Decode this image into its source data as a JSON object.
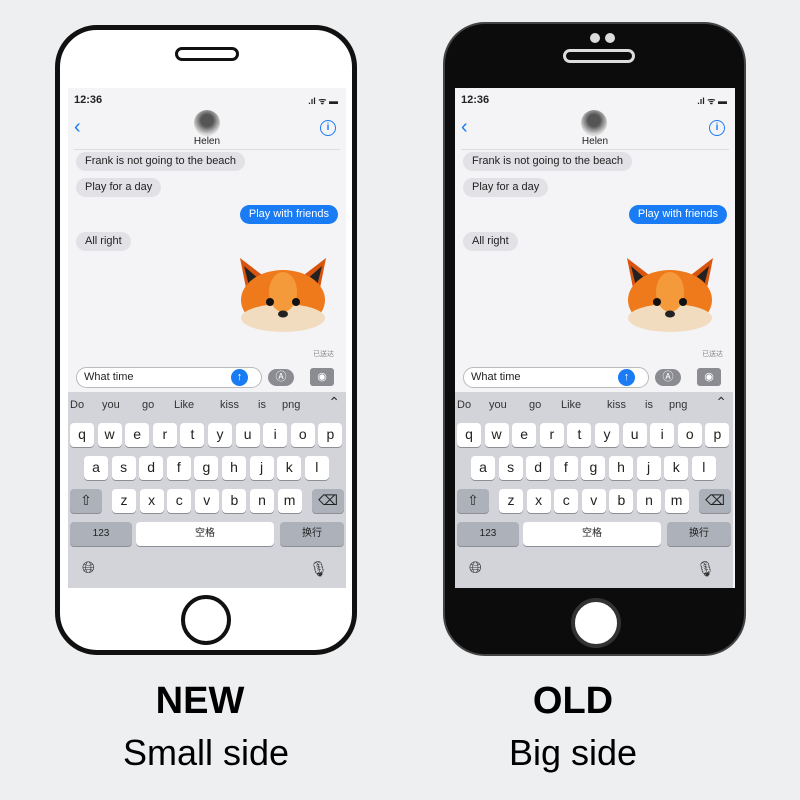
{
  "screen": {
    "status_time": "12:36",
    "contact_name": "Helen",
    "messages": [
      {
        "text": "Frank is not going to the beach",
        "dir": "in"
      },
      {
        "text": "Play for a day",
        "dir": "in"
      },
      {
        "text": "Play with friends",
        "dir": "out"
      },
      {
        "text": "All right",
        "dir": "in"
      }
    ],
    "sticker": "fox-memoji",
    "delivered_label": "已送达",
    "input_value": "What time",
    "suggestions": [
      "Do",
      "you",
      "go",
      "Like",
      "kiss",
      "is",
      "png"
    ],
    "keyboard": {
      "row1": [
        "q",
        "w",
        "e",
        "r",
        "t",
        "y",
        "u",
        "i",
        "o",
        "p"
      ],
      "row2": [
        "a",
        "s",
        "d",
        "f",
        "g",
        "h",
        "j",
        "k",
        "l"
      ],
      "row3": [
        "z",
        "x",
        "c",
        "v",
        "b",
        "n",
        "m"
      ],
      "numbers_label": "123",
      "space_label": "空格",
      "return_label": "换行"
    },
    "accent_color": "#1a7cf4"
  },
  "captions": {
    "new_title": "NEW",
    "new_sub": "Small side",
    "old_title": "OLD",
    "old_sub": "Big side"
  }
}
